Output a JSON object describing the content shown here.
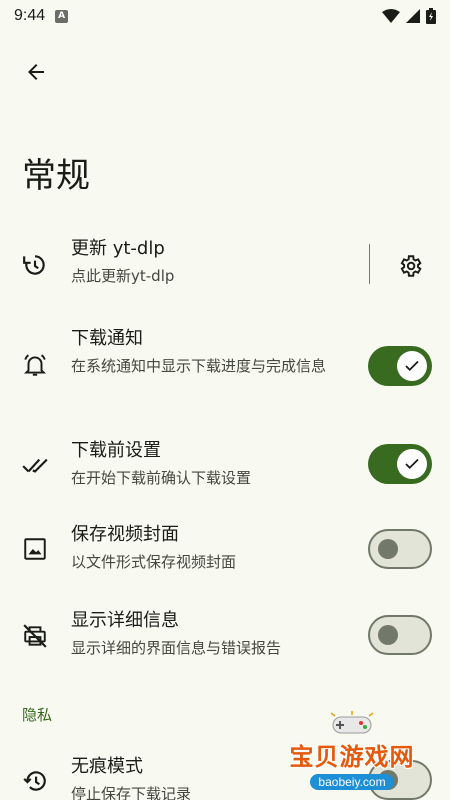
{
  "status_bar": {
    "time": "9:44",
    "notif_letter": "A"
  },
  "page": {
    "title": "常规"
  },
  "settings": [
    {
      "title": "更新 yt-dlp",
      "subtitle": "点此更新yt-dlp"
    },
    {
      "title": "下载通知",
      "subtitle": "在系统通知中显示下载进度与完成信息",
      "enabled": true
    },
    {
      "title": "下载前设置",
      "subtitle": "在开始下载前确认下载设置",
      "enabled": true
    },
    {
      "title": "保存视频封面",
      "subtitle": "以文件形式保存视频封面",
      "enabled": false
    },
    {
      "title": "显示详细信息",
      "subtitle": "显示详细的界面信息与错误报告",
      "enabled": false
    }
  ],
  "privacy": {
    "header": "隐私",
    "items": [
      {
        "title": "无痕模式",
        "subtitle": "停止保存下载记录"
      }
    ]
  },
  "watermark": {
    "title": "宝贝游戏网",
    "url": "baobeiy.com"
  },
  "colors": {
    "background": "#f8f9f1",
    "accent": "#386a20",
    "switch_off": "#e1e4d6"
  }
}
